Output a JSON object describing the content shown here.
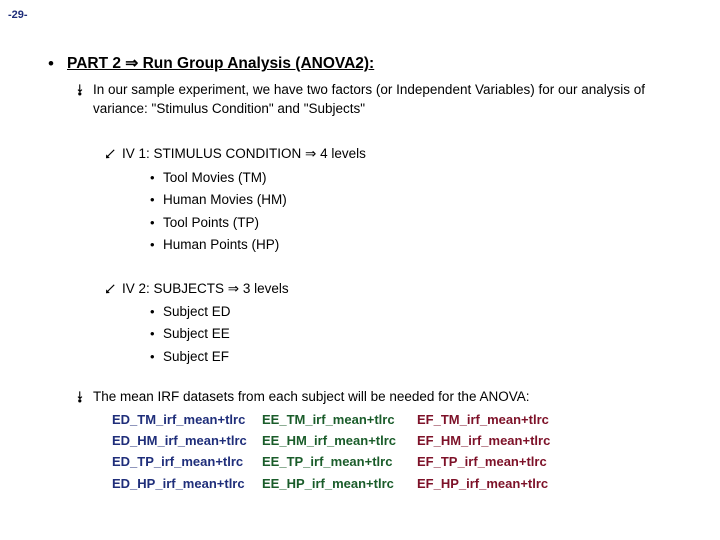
{
  "slide": {
    "page_number": "-29-",
    "title": "PART 2 ⇒  Run Group Analysis (ANOVA2):",
    "intro_paragraph": "In our sample experiment, we have two factors (or Independent Variables) for our analysis of variance: \"Stimulus Condition\" and \"Subjects\"",
    "mean_irf_paragraph": "The mean IRF datasets from each subject will be needed for the ANOVA:"
  },
  "markers": {
    "main_bullet": "•",
    "hand_glyph": "hand-pointer-glyph",
    "arrow_glyph": "south-west-arrow",
    "round_bullet": "•"
  },
  "independent_variables": [
    {
      "heading": "IV 1: STIMULUS CONDITION ⇒ 4 levels",
      "levels": [
        "Tool Movies (TM)",
        "Human Movies (HM)",
        "Tool Points (TP)",
        "Human Points (HP)"
      ]
    },
    {
      "heading": "IV 2: SUBJECTS ⇒ 3 levels",
      "levels": [
        "Subject ED",
        "Subject EE",
        "Subject EF"
      ]
    }
  ],
  "dataset_table": {
    "rows": [
      [
        "ED_TM_irf_mean+tlrc",
        "EE_TM_irf_mean+tlrc",
        "EF_TM_irf_mean+tlrc"
      ],
      [
        "ED_HM_irf_mean+tlrc",
        "EE_HM_irf_mean+tlrc",
        "EF_HM_irf_mean+tlrc"
      ],
      [
        "ED_TP_irf_mean+tlrc",
        "EE_TP_irf_mean+tlrc",
        "EF_TP_irf_mean+tlrc"
      ],
      [
        "ED_HP_irf_mean+tlrc",
        "EE_HP_irf_mean+tlrc",
        "EF_HP_irf_mean+tlrc"
      ]
    ]
  },
  "colors": {
    "page_number": "#1f2e7a",
    "subject_ed": "#1f2e7a",
    "subject_ee": "#1a5c2a",
    "subject_ef": "#7d1128",
    "body_text": "#000000",
    "background": "#ffffff"
  }
}
